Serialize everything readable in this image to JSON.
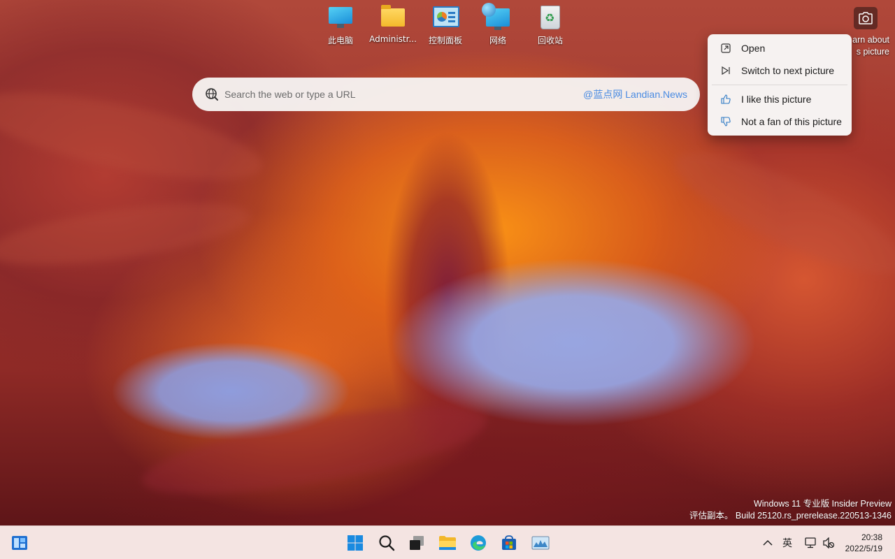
{
  "desktop": {
    "icons": [
      {
        "label": "此电脑",
        "icon": "this-pc-icon"
      },
      {
        "label": "Administr...",
        "icon": "user-folder-icon"
      },
      {
        "label": "控制面板",
        "icon": "control-panel-icon"
      },
      {
        "label": "网络",
        "icon": "network-icon"
      },
      {
        "label": "回收站",
        "icon": "recycle-bin-icon"
      }
    ]
  },
  "spotlight": {
    "learn_line1": "arn about",
    "learn_line2": "s picture",
    "camera_icon": "camera-icon"
  },
  "search": {
    "placeholder": "Search the web or type a URL",
    "watermark": "@蓝点网 Landian.News",
    "icon": "bing-search-icon"
  },
  "context_menu": {
    "items": [
      {
        "label": "Open",
        "icon": "open-external-icon"
      },
      {
        "label": "Switch to next picture",
        "icon": "next-picture-icon"
      },
      {
        "label": "I like this picture",
        "icon": "thumbs-up-icon"
      },
      {
        "label": "Not a fan of this picture",
        "icon": "thumbs-down-icon"
      }
    ]
  },
  "build_info": {
    "line1": "Windows 11 专业版 Insider Preview",
    "line2": "评估副本。 Build 25120.rs_prerelease.220513-1346"
  },
  "taskbar": {
    "apps": [
      "widgets-icon",
      "start-icon",
      "search-icon",
      "task-view-icon",
      "file-explorer-icon",
      "edge-icon",
      "store-icon",
      "photos-icon"
    ],
    "tray": {
      "chevron": "^",
      "ime": "英",
      "network_icon": "network-tray-icon",
      "volume_icon": "volume-muted-icon"
    },
    "clock": {
      "time": "20:38",
      "date": "2022/5/19"
    }
  },
  "colors": {
    "accent": "#0067c0",
    "taskbar_bg": "#f4e4e2",
    "watermark_blue": "#4a8be2"
  }
}
